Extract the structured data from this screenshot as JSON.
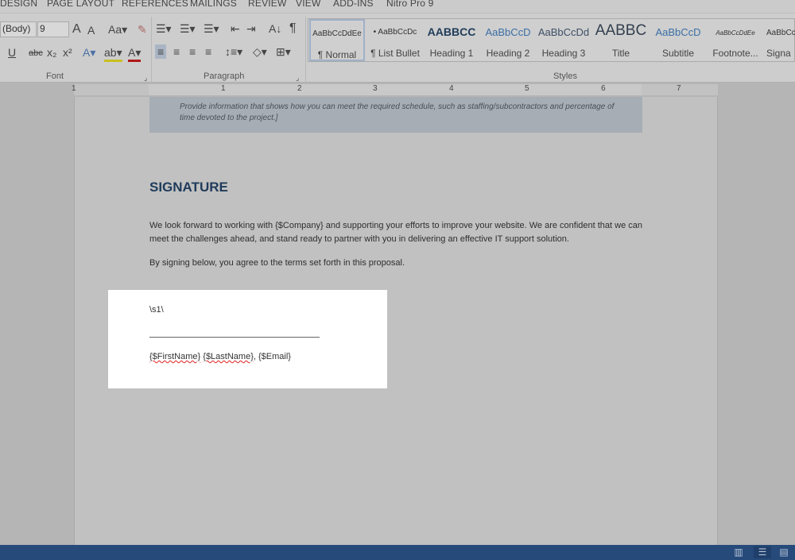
{
  "tabs": [
    "DESIGN",
    "PAGE LAYOUT",
    "REFERENCES",
    "MAILINGS",
    "REVIEW",
    "VIEW",
    "ADD-INS",
    "Nitro Pro 9"
  ],
  "font": {
    "name": "(Body)",
    "size": "9",
    "group_label": "Font"
  },
  "paragraph": {
    "group_label": "Paragraph"
  },
  "styles": {
    "group_label": "Styles",
    "items": [
      {
        "preview": "AaBbCcDdEe",
        "name": "¶ Normal"
      },
      {
        "preview": "• AaBbCcDc",
        "name": "¶ List Bullet"
      },
      {
        "preview": "AABBCC",
        "name": "Heading 1"
      },
      {
        "preview": "AaBbCcD",
        "name": "Heading 2"
      },
      {
        "preview": "AaBbCcDd",
        "name": "Heading 3"
      },
      {
        "preview": "AABBC",
        "name": "Title"
      },
      {
        "preview": "AaBbCcD",
        "name": "Subtitle"
      },
      {
        "preview": "AaBbCcDdEe",
        "name": "Footnote..."
      },
      {
        "preview": "AaBbCc",
        "name": "Signa"
      }
    ]
  },
  "ruler": [
    "1",
    "1",
    "2",
    "3",
    "4",
    "5",
    "6",
    "7"
  ],
  "document": {
    "shaded_text": "Provide information that shows how you can meet the required schedule, such as staffing/subcontractors and percentage of time devoted to the project.]",
    "heading": "SIGNATURE",
    "para1": "We look forward to working with {$Company} and supporting your efforts to improve your website. We are confident that we can meet the challenges ahead, and stand ready to partner with you in delivering an effective IT support solution.",
    "para2": "By signing below, you agree to the terms set forth in this proposal.",
    "sig_tag": "\\s1\\",
    "sig_first": "{$FirstName}",
    "sig_last": "{$LastName}",
    "sig_email": ", {$Email}"
  },
  "colors": {
    "heading": "#1f3b5a",
    "status_bar": "#264a7a"
  }
}
